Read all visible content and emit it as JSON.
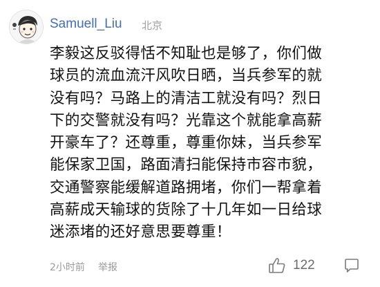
{
  "comment": {
    "username": "Samuell_Liu",
    "location": "北京",
    "avatar_icon": "cartoon-avatar-icon",
    "content": "李毅这反驳得恬不知耻也是够了，你们做\n球员的流血流汗风吹日晒，当兵参军的就\n没有吗？马路上的清洁工就没有吗？烈日\n下的交警就没有吗？光靠这个就能拿高薪\n开豪车了？还尊重，尊重你妹，当兵参军\n能保家卫国，路面清扫能保持市容市貌，\n交通警察能缓解道路拥堵，你们一帮拿着\n高薪成天输球的货除了十几年如一日给球\n迷添堵的还好意思要尊重！",
    "time": "2小时前",
    "report_label": "举报",
    "likes": "122",
    "like_icon": "thumbs-up-icon",
    "reply_icon": "comment-bubble-icon"
  },
  "colors": {
    "username": "#3f6fb4",
    "meta": "#9a9a9a",
    "text": "#111111"
  }
}
